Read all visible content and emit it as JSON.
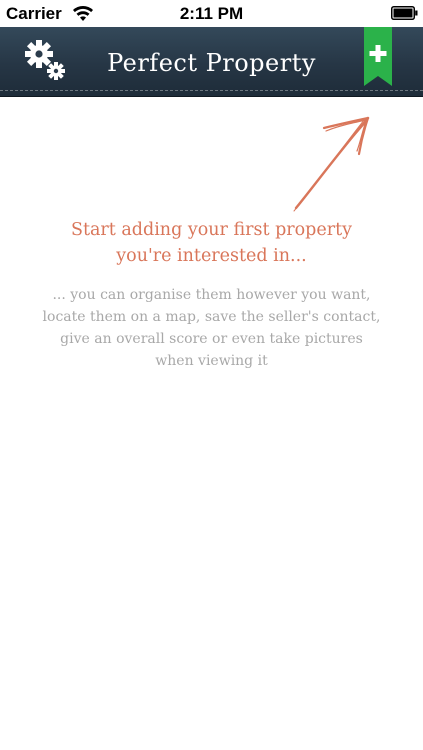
{
  "status_bar": {
    "carrier": "Carrier",
    "time": "2:11 PM",
    "wifi_icon": "wifi-icon",
    "battery_icon": "battery-icon"
  },
  "nav_bar": {
    "title": "Perfect Property",
    "settings_icon": "gears-icon",
    "add_icon": "plus-bookmark-icon",
    "add_color": "#2bb24a",
    "background_color": "#263645"
  },
  "empty_state": {
    "title_line_1": "Start adding your first property",
    "title_line_2": "you're interested in...",
    "description": "... you can organise them however you want, locate them on a map, save the seller's contact, give an overall score or even take pictures when viewing it",
    "arrow_icon": "hand-drawn-arrow-icon",
    "title_color": "#d9765a",
    "description_color": "#a8a8a8"
  }
}
